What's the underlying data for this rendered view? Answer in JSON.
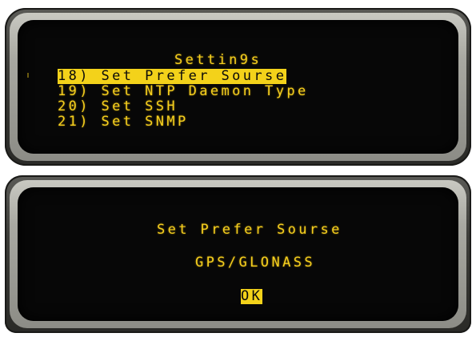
{
  "menu_screen": {
    "title": "Settin9s",
    "items": [
      {
        "label": "18) Set Prefer Sourse",
        "selected": true
      },
      {
        "label": "19) Set NTP Daemon Type",
        "selected": false
      },
      {
        "label": "20) Set SSH",
        "selected": false
      },
      {
        "label": "21) Set SNMP",
        "selected": false
      }
    ]
  },
  "dialog_screen": {
    "title": "Set Prefer Sourse",
    "value": "GPS/GLONASS",
    "ok_label": "OK"
  },
  "colors": {
    "lcd_text": "#f5cf1e",
    "highlight": "#f3d21a",
    "screen_bg": "#070707"
  }
}
